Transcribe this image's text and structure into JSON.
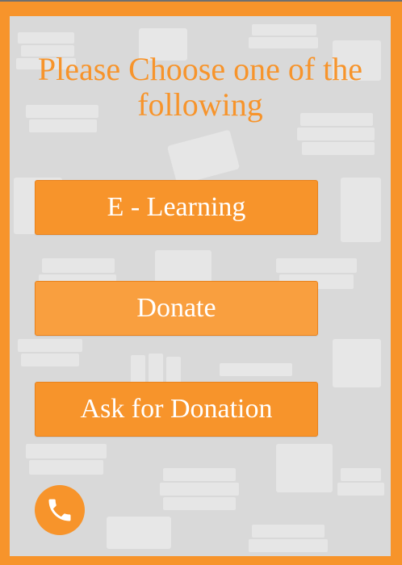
{
  "heading": "Please Choose one of the following",
  "buttons": {
    "elearning": "E - Learning",
    "donate": "Donate",
    "ask_donation": "Ask for Donation"
  },
  "call_button": {
    "icon": "phone-icon"
  },
  "colors": {
    "accent": "#f7942b",
    "panel": "#d9d9d9",
    "pattern": "#ececec",
    "button_text": "#ffffff"
  }
}
